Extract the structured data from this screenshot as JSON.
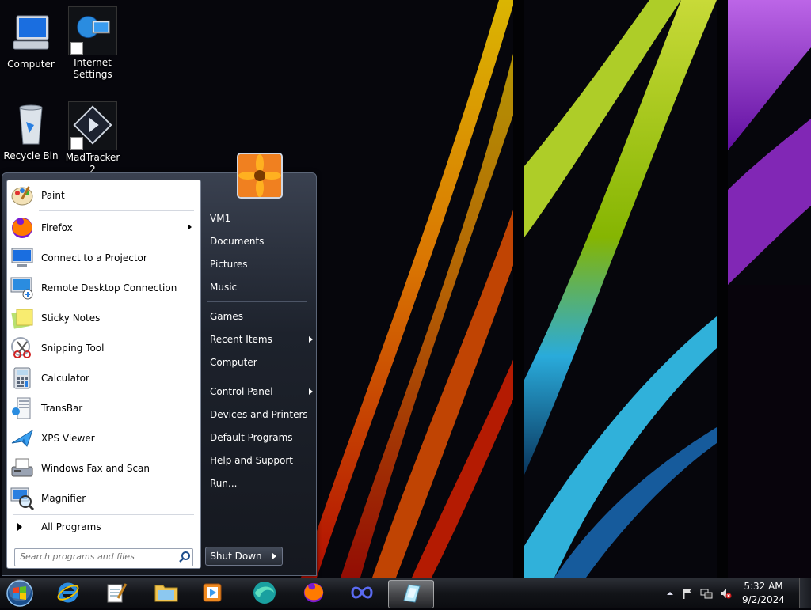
{
  "desktop": {
    "icons": [
      {
        "label": "Computer"
      },
      {
        "label": "Internet\nSettings",
        "line1": "Internet",
        "line2": "Settings"
      },
      {
        "label": "Recycle Bin"
      },
      {
        "label": "MadTracker 2"
      }
    ]
  },
  "start_menu": {
    "programs": [
      {
        "label": "Paint",
        "icon": "paint-icon"
      },
      {
        "label": "Firefox",
        "icon": "firefox-icon",
        "has_submenu": true
      },
      {
        "label": "Connect to a Projector",
        "icon": "projector-icon"
      },
      {
        "label": "Remote Desktop Connection",
        "icon": "remote-desktop-icon"
      },
      {
        "label": "Sticky Notes",
        "icon": "sticky-notes-icon"
      },
      {
        "label": "Snipping Tool",
        "icon": "snipping-tool-icon"
      },
      {
        "label": "Calculator",
        "icon": "calculator-icon"
      },
      {
        "label": "TransBar",
        "icon": "transbar-icon"
      },
      {
        "label": "XPS Viewer",
        "icon": "xps-viewer-icon"
      },
      {
        "label": "Windows Fax and Scan",
        "icon": "fax-scan-icon"
      },
      {
        "label": "Magnifier",
        "icon": "magnifier-icon"
      }
    ],
    "all_programs": "All Programs",
    "search_placeholder": "Search programs and files",
    "right_items": [
      {
        "label": "VM1"
      },
      {
        "label": "Documents"
      },
      {
        "label": "Pictures"
      },
      {
        "label": "Music"
      },
      {
        "label": "Games"
      },
      {
        "label": "Recent Items",
        "has_submenu": true
      },
      {
        "label": "Computer"
      },
      {
        "label": "Control Panel",
        "has_submenu": true
      },
      {
        "label": "Devices and Printers"
      },
      {
        "label": "Default Programs"
      },
      {
        "label": "Help and Support"
      },
      {
        "label": "Run..."
      }
    ],
    "shutdown_label": "Shut Down"
  },
  "taskbar": {
    "pinned": [
      "internet-explorer-icon",
      "notepad-icon",
      "file-explorer-icon",
      "media-player-icon",
      "browser-icon",
      "firefox-icon",
      "infinity-app-icon",
      "transbar-app-icon"
    ],
    "clock_time": "5:32 AM",
    "clock_date": "9/2/2024"
  },
  "colors": {
    "wallpaper_orange": "#ff8a00",
    "wallpaper_green": "#b8e000",
    "wallpaper_cyan": "#30c8ff",
    "wallpaper_purple": "#b040ff"
  }
}
